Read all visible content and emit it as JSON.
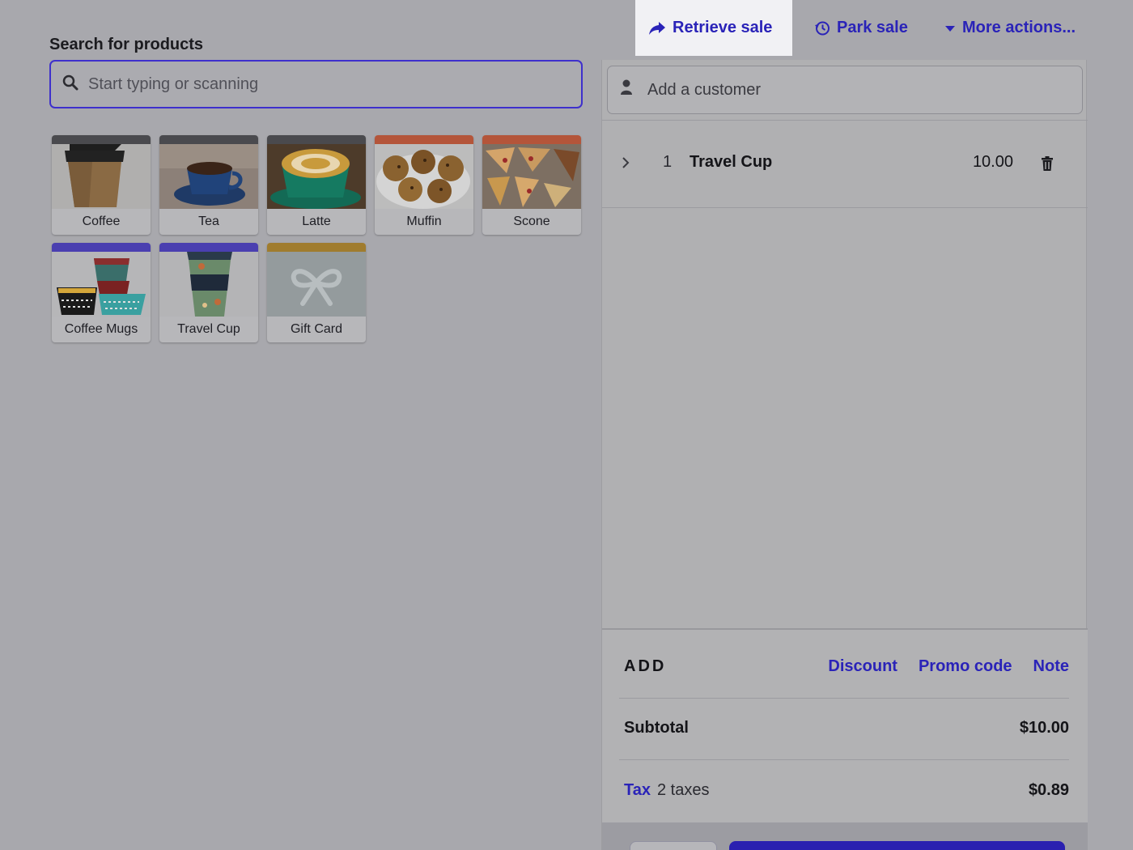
{
  "topbar": {
    "retrieve_label": "Retrieve sale",
    "park_label": "Park sale",
    "more_label": "More actions..."
  },
  "search": {
    "label": "Search for products",
    "placeholder": "Start typing or scanning"
  },
  "products": [
    {
      "name": "Coffee",
      "band_color": "#4a4a4e"
    },
    {
      "name": "Tea",
      "band_color": "#4a4a4e"
    },
    {
      "name": "Latte",
      "band_color": "#4a4a4e"
    },
    {
      "name": "Muffin",
      "band_color": "#b4553a"
    },
    {
      "name": "Scone",
      "band_color": "#b4553a"
    },
    {
      "name": "Coffee Mugs",
      "band_color": "#4a3fb0"
    },
    {
      "name": "Travel Cup",
      "band_color": "#4a3fb0"
    },
    {
      "name": "Gift Card",
      "band_color": "#a07c2e"
    }
  ],
  "customer": {
    "placeholder": "Add a customer"
  },
  "cart": {
    "items": [
      {
        "qty": "1",
        "name": "Travel Cup",
        "price": "10.00"
      }
    ]
  },
  "summary": {
    "add_title": "ADD",
    "discount": "Discount",
    "promo": "Promo code",
    "note": "Note",
    "subtotal_label": "Subtotal",
    "subtotal_value": "$10.00",
    "tax_label": "Tax",
    "tax_count": "2 taxes",
    "tax_value": "$0.89"
  },
  "colors": {
    "accent": "#2a23b8",
    "overlay_bg": "#a8a8ad"
  }
}
